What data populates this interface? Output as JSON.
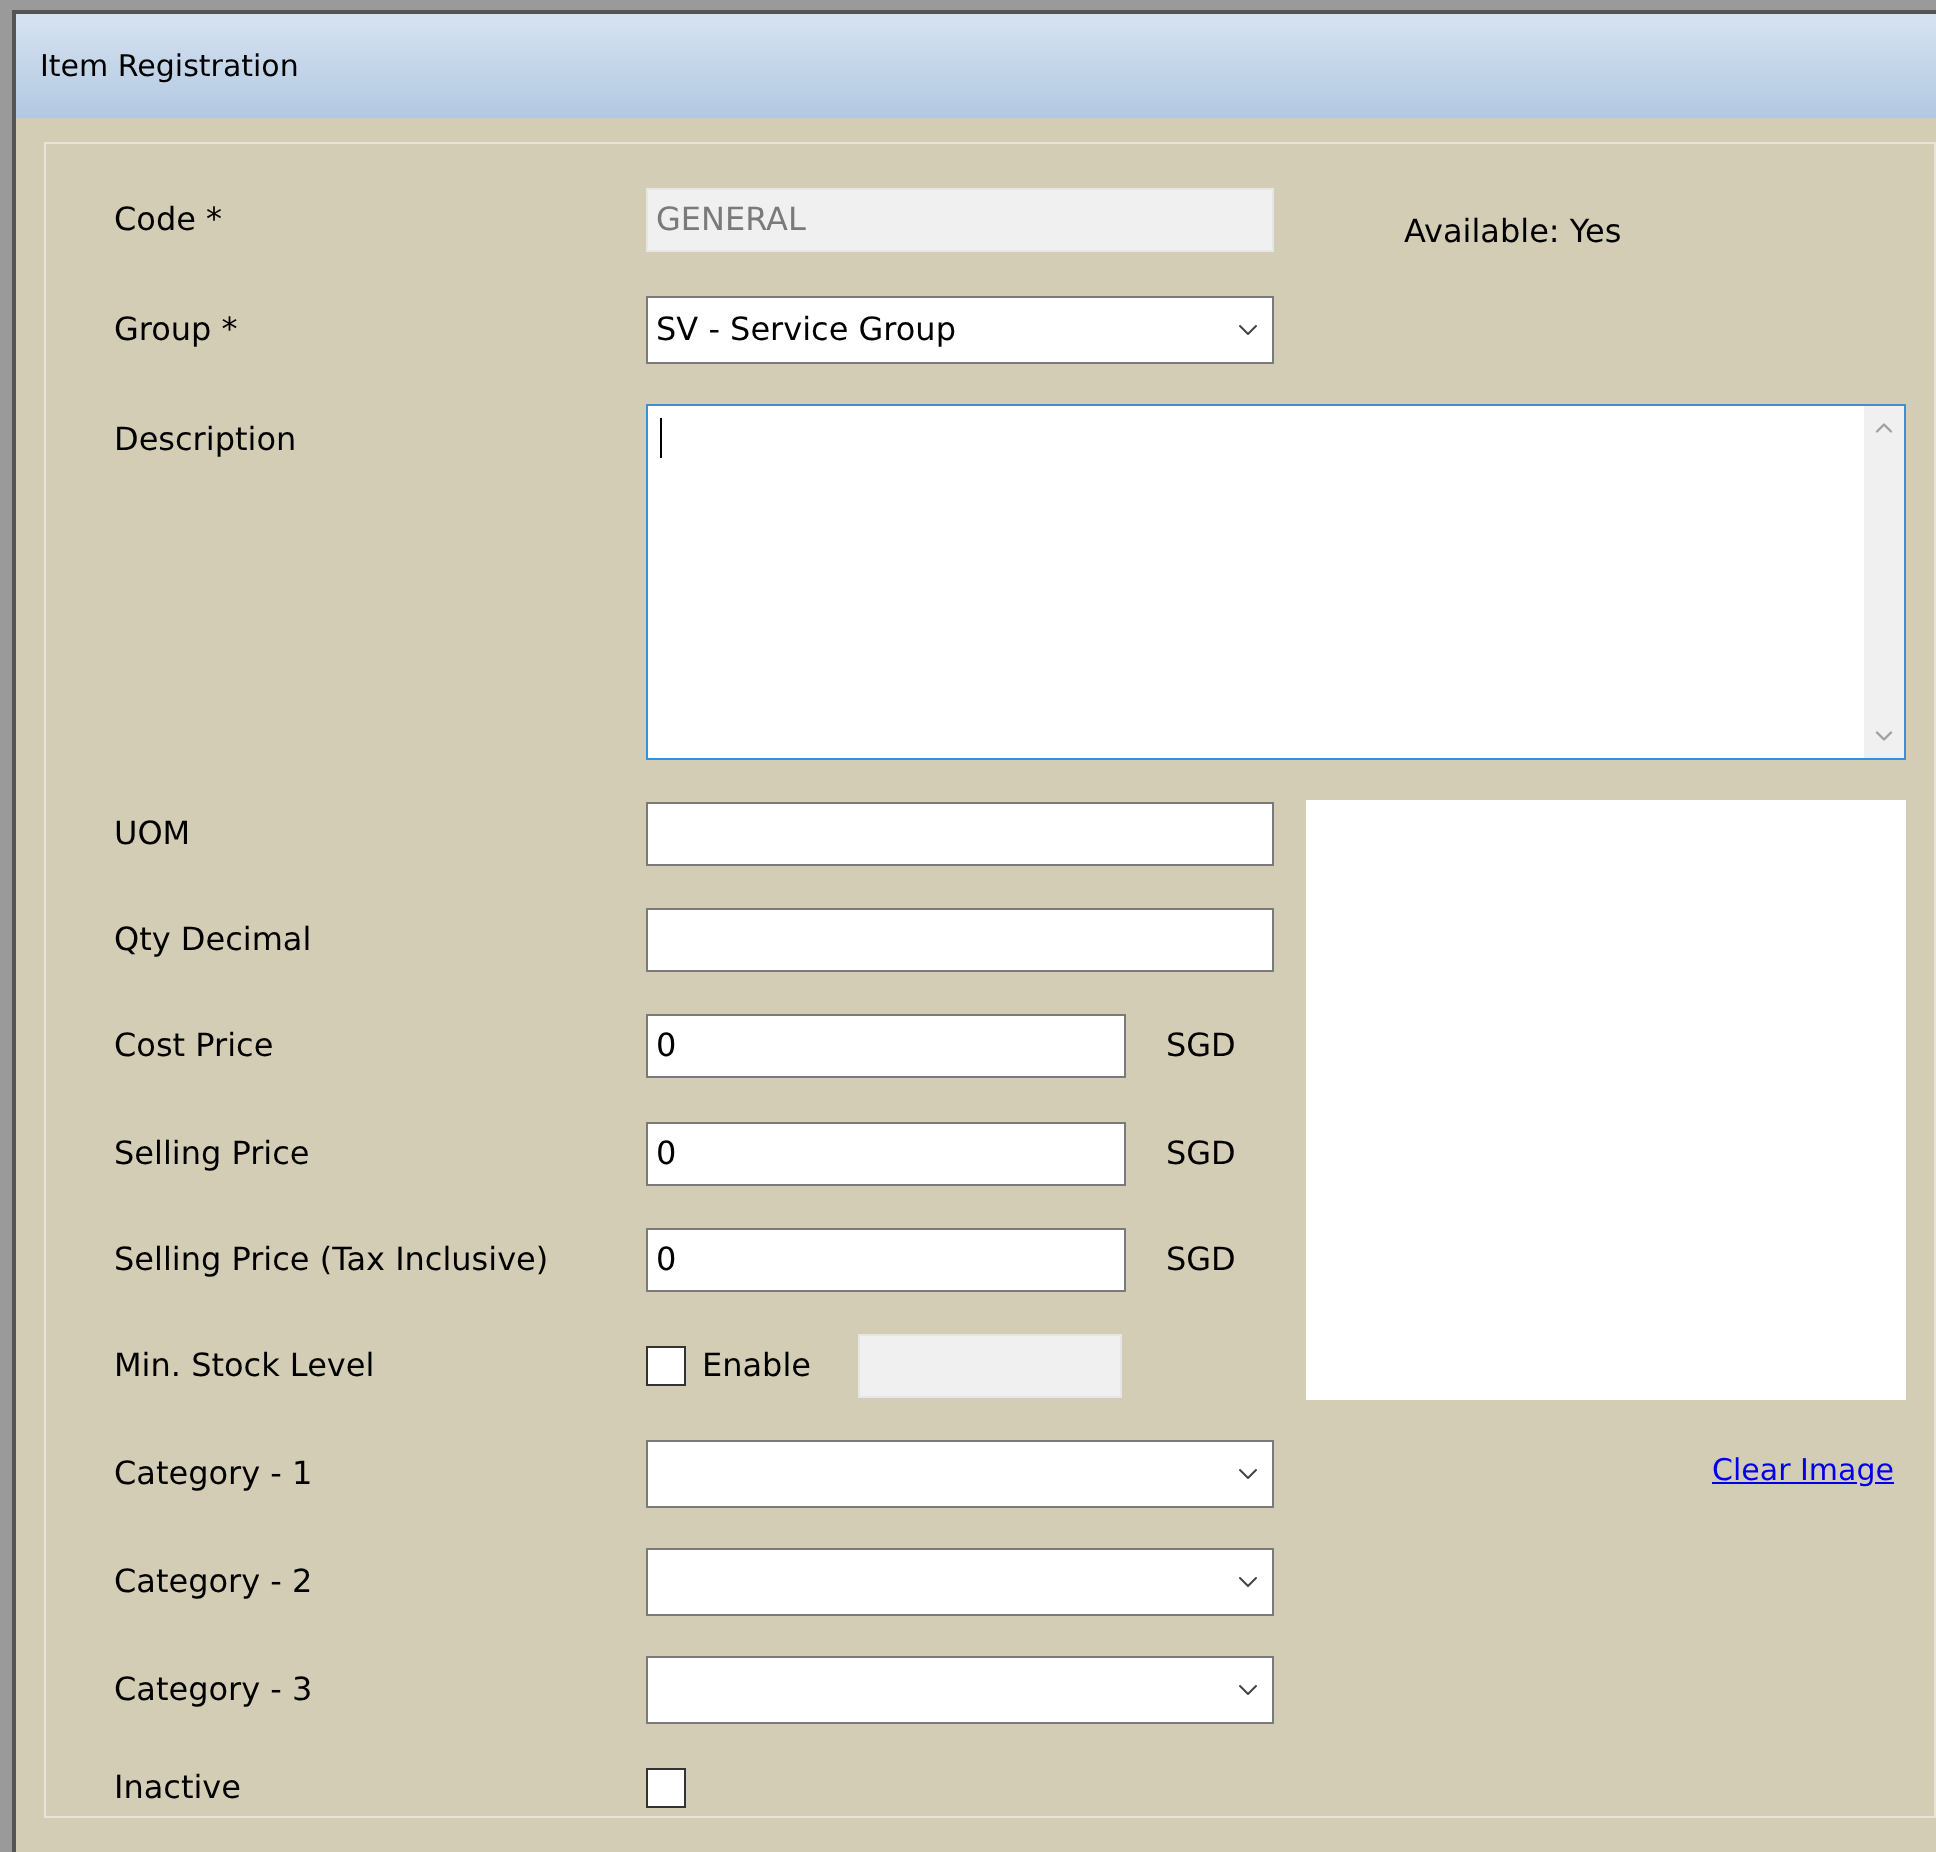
{
  "window": {
    "title": "Item Registration"
  },
  "availability": "Available: Yes",
  "fields": [
    {
      "kind": "text",
      "label": "Code *",
      "value": "GENERAL",
      "disabled": true
    },
    {
      "kind": "select",
      "label": "Group *",
      "value": "SV - Service Group"
    },
    {
      "kind": "textarea",
      "label": "Description",
      "focused": true
    },
    {
      "kind": "text",
      "label": "UOM",
      "disabled": false
    },
    {
      "kind": "text",
      "label": "Qty Decimal",
      "disabled": false
    },
    {
      "kind": "price",
      "label": "Cost Price",
      "value": "0",
      "currency": "SGD"
    },
    {
      "kind": "price",
      "label": "Selling Price",
      "value": "0",
      "currency": "SGD"
    },
    {
      "kind": "price",
      "label": "Selling Price (Tax Inclusive)",
      "value": "0",
      "currency": "SGD"
    },
    {
      "kind": "stock",
      "label": "Min. Stock Level",
      "checkbox_label": "Enable",
      "checked": false
    },
    {
      "kind": "select",
      "label": "Category - 1"
    },
    {
      "kind": "select",
      "label": "Category - 2"
    },
    {
      "kind": "select",
      "label": "Category - 3"
    },
    {
      "kind": "checkbox",
      "label": "Inactive",
      "checked": false
    }
  ],
  "clear_image_link": "Clear Image"
}
